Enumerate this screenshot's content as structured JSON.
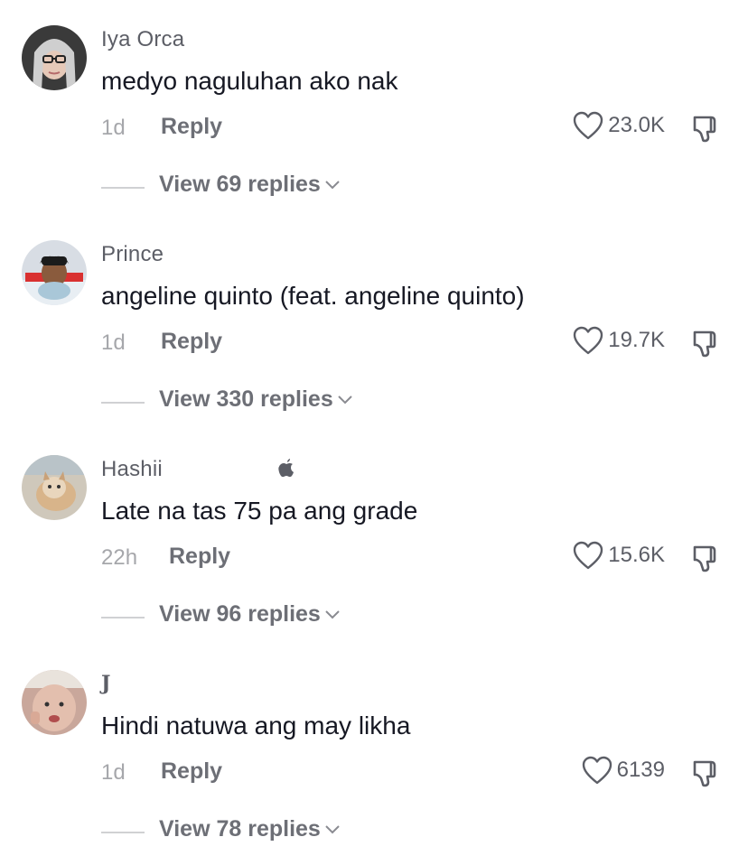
{
  "comments": [
    {
      "username": "Iya Orca",
      "text": "medyo naguluhan ako nak",
      "time": "1d",
      "reply_label": "Reply",
      "likes": "23.0K",
      "view_replies": "View 69 replies",
      "avatar_bg": "#3a3a3a"
    },
    {
      "username": "Prince",
      "text": "angeline quinto (feat. angeline quinto)",
      "time": "1d",
      "reply_label": "Reply",
      "likes": "19.7K",
      "view_replies": "View 330 replies",
      "avatar_bg": "#d8dde4"
    },
    {
      "username": "Hashii",
      "badge_icon": "apple-icon",
      "text": "Late na tas 75 pa ang grade",
      "time": "22h",
      "reply_label": "Reply",
      "likes": "15.6K",
      "view_replies": "View 96 replies",
      "avatar_bg": "#cfc8bb"
    },
    {
      "username": "J",
      "text": "Hindi natuwa ang may likha",
      "time": "1d",
      "reply_label": "Reply",
      "likes": "6139",
      "view_replies": "View 78 replies",
      "avatar_bg": "#c9a79b"
    }
  ],
  "icons": {
    "like": "heart-outline-icon",
    "dislike": "thumbs-down-icon",
    "expand": "chevron-down-icon"
  },
  "colors": {
    "text_primary": "#161823",
    "text_secondary": "#5c5e66",
    "text_muted": "#a6a7ab"
  }
}
